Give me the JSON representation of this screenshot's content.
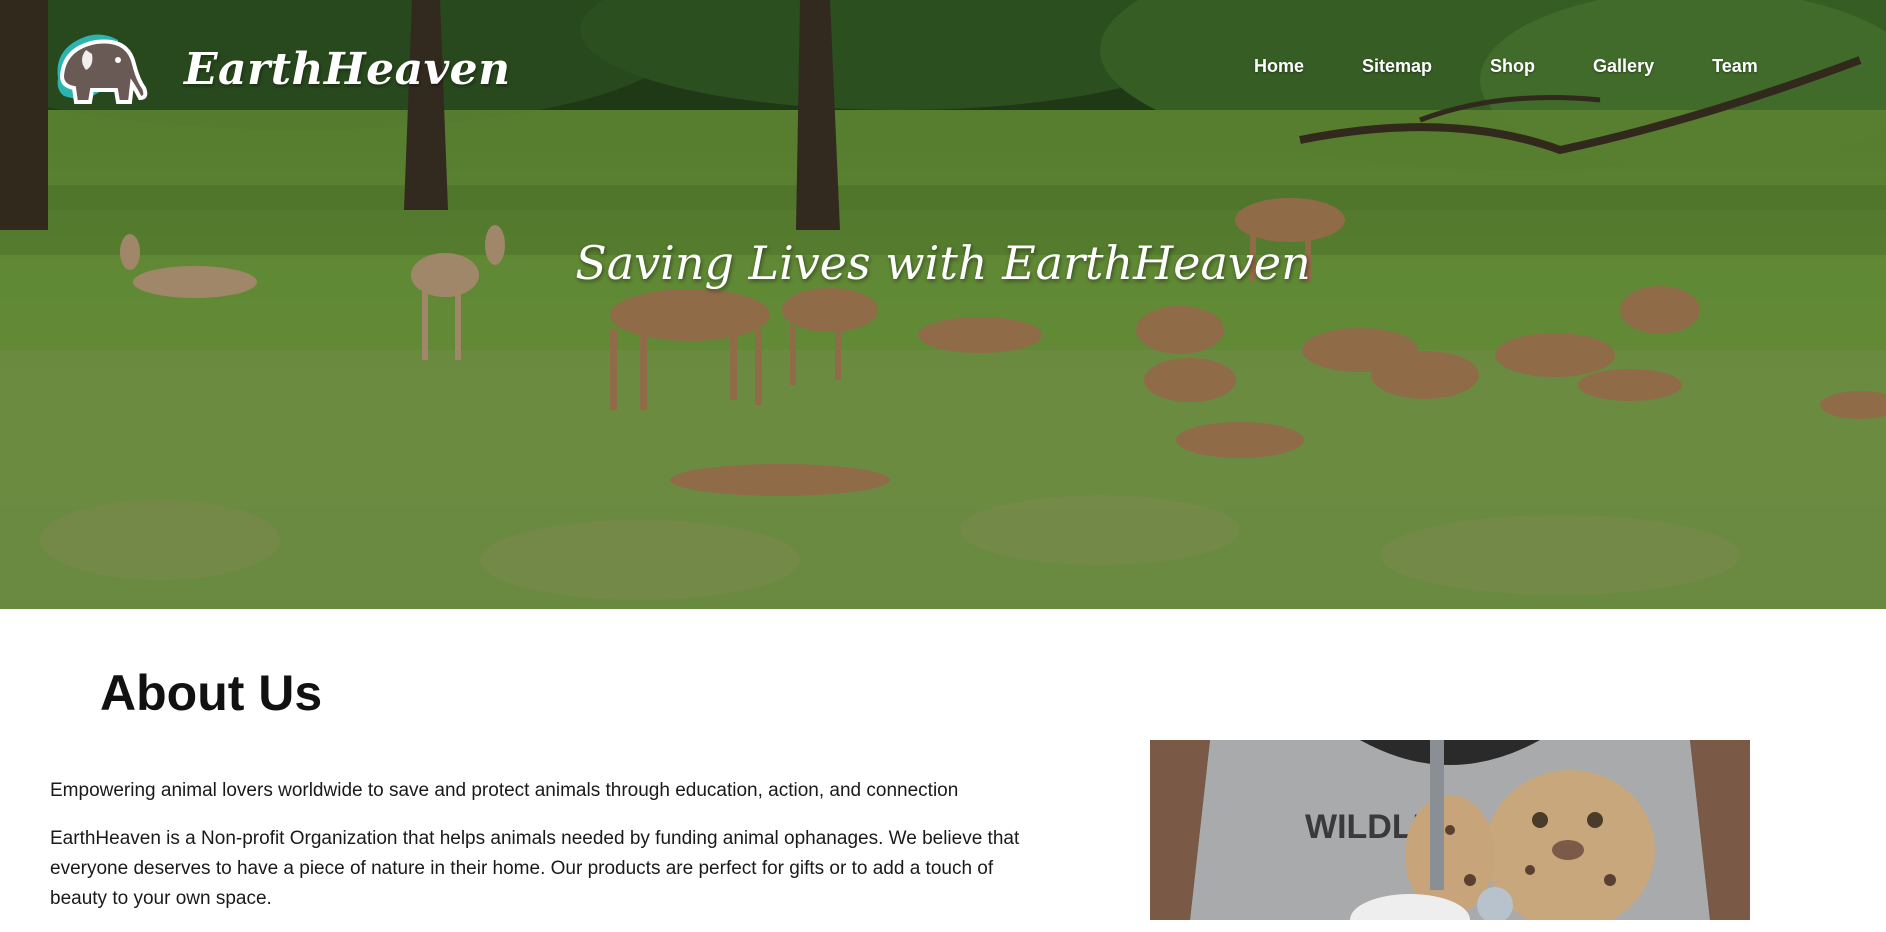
{
  "brand": {
    "name": "EarthHeaven",
    "logo_icon": "elephant-logo-icon"
  },
  "nav": {
    "items": [
      {
        "label": "Home"
      },
      {
        "label": "Sitemap"
      },
      {
        "label": "Shop"
      },
      {
        "label": "Gallery"
      },
      {
        "label": "Team"
      }
    ]
  },
  "hero": {
    "title": "Saving Lives with EarthHeaven",
    "background_icon": "deer-meadow-photo"
  },
  "about": {
    "heading": "About Us",
    "tagline": "Empowering animal lovers worldwide to save and protect animals through education, action, and connection",
    "body": "EarthHeaven is a Non-profit Organization that helps animals needed by funding animal ophanages. We believe that everyone deserves to have a piece of nature in their home. Our products are perfect for gifts or to add a touch of beauty to your own space.",
    "photo_icon": "leopard-cub-photo",
    "photo_shirt_text": "WILDLIFE"
  },
  "colors": {
    "nav_text": "#ffffff",
    "heading_text": "#111111",
    "body_text": "#1a1a1a",
    "logo_body": "#6a5a55",
    "logo_accent": "#2bb5b0"
  }
}
